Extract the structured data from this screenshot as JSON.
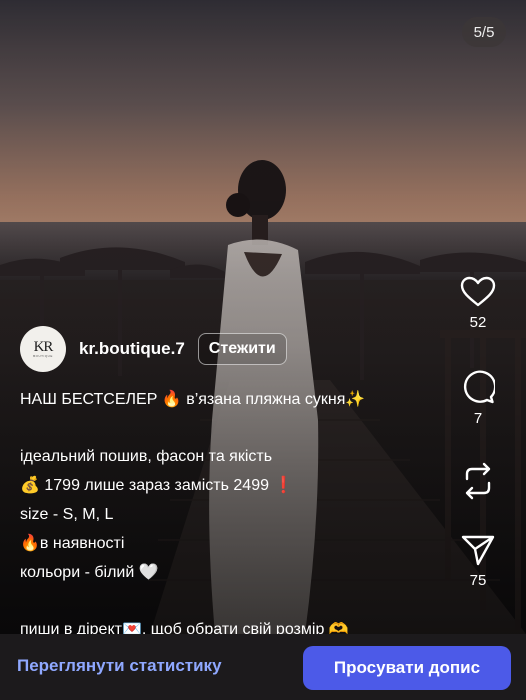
{
  "post": {
    "counter": "5/5",
    "author": {
      "username": "kr.boutique.7",
      "avatar_mono": "KR",
      "avatar_sub": "BOUTIQUE"
    },
    "follow_label": "Стежити",
    "likes": "52",
    "comments": "7",
    "shares": "75",
    "caption": {
      "l1_text": "НАШ БЕСТСЕЛЕР",
      "l1_emoji": "🔥",
      "l1_text2": "в’язана пляжна сукня",
      "l1_emoji2": "✨",
      "l2": "ідеальний пошив, фасон та якість",
      "l3_emoji": "💰",
      "l3_text": "1799 лише зараз замість 2499",
      "l3_emoji2": "❗",
      "l4": "size - S, M, L",
      "l5_emoji": "🔥",
      "l5_text": "в наявності",
      "l6_text": "кольори - білий",
      "l6_emoji": "🤍",
      "l7_text": "пиши в дірект",
      "l7_emoji": "💌",
      "l7_text2": ", щоб обрати свій розмір",
      "l7_emoji2": "🫶"
    }
  },
  "bottom_bar": {
    "stats_label": "Переглянути статистику",
    "promote_label": "Просувати допис"
  },
  "icons": {
    "like": "heart-icon",
    "comment": "comment-icon",
    "repost": "repost-icon",
    "share": "share-icon"
  },
  "colors": {
    "accent": "#4c5ae8",
    "link": "#8fa8ff",
    "background": "#1c1a1c"
  }
}
